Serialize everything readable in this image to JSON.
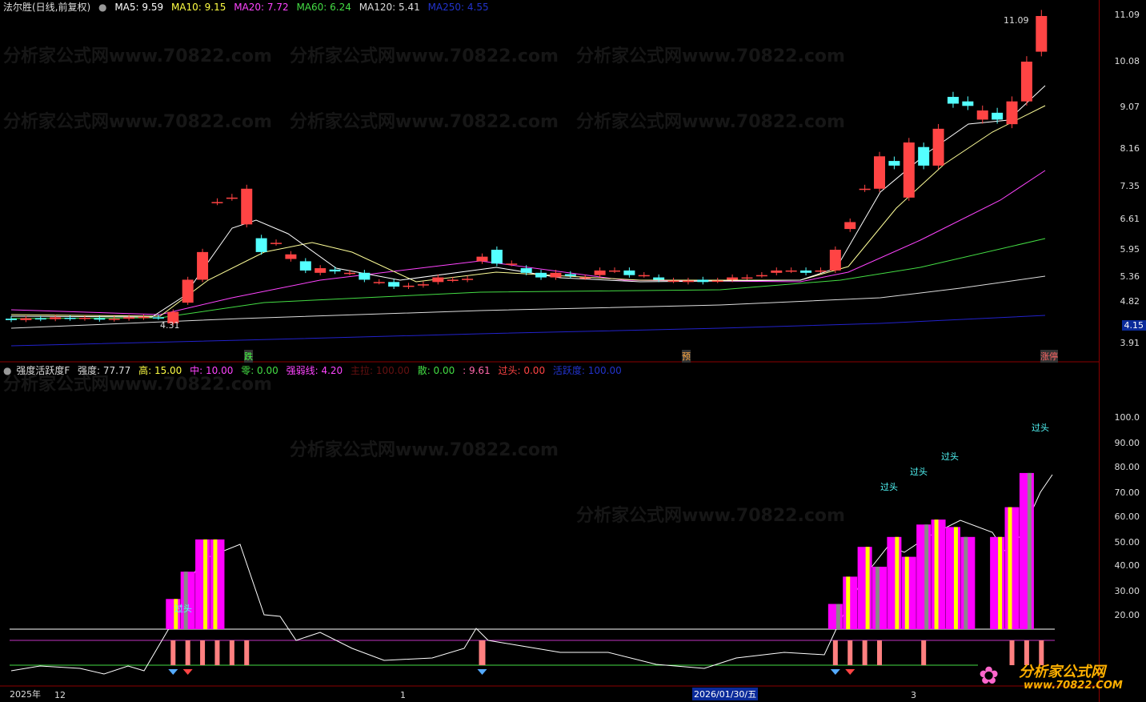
{
  "top_legend": {
    "title": "法尔胜(日线,前复权)",
    "ma5": "MA5: 9.59",
    "ma10": "MA10: 9.15",
    "ma20": "MA20: 7.72",
    "ma60": "MA60: 6.24",
    "ma120": "MA120: 5.41",
    "ma250": "MA250: 4.55"
  },
  "ind_legend": {
    "name": "强度活跃度F",
    "strength": "强度: 77.77",
    "high": "高: 15.00",
    "mid": "中: 10.00",
    "zero": "零: 0.00",
    "line": "强弱线: 4.20",
    "main": "主拉: 100.00",
    "scatter": "散: 0.00",
    "sep": ": 9.61",
    "over": "过头: 0.00",
    "active": "活跃度: 100.00"
  },
  "price_axis": [
    "11.09",
    "10.08",
    "9.07",
    "8.16",
    "7.35",
    "6.61",
    "5.95",
    "5.36",
    "4.82",
    "3.91"
  ],
  "price_current": "4.15",
  "ind_axis": [
    "100.0",
    "90.00",
    "80.00",
    "70.00",
    "60.00",
    "50.00",
    "40.00",
    "30.00",
    "20.00"
  ],
  "annotations": {
    "max": "11.09",
    "min": "4.31",
    "fall": "跌",
    "pre": "预",
    "limit": "涨停",
    "over": "过头"
  },
  "time_axis": [
    "2025年",
    "12",
    "1",
    "2026/01/30/五",
    "3"
  ],
  "watermark": "分析家公式网www.70822.com",
  "logo": {
    "name": "分析家公式网",
    "url": "www.70822.COM"
  },
  "colors": {
    "up": "#ff4444",
    "down": "#54ffff",
    "ma5": "#ffffff",
    "ma10": "#ffff66",
    "ma20": "#ff44ff",
    "ma60": "#44dd44",
    "ma120": "#dddddd",
    "ma250": "#2222cc",
    "bar": "#ff00ff",
    "stripe": "#ffff00",
    "gray": "#888888"
  },
  "chart_data": {
    "type": "candlestick",
    "candles": [
      [
        4.45,
        4.42
      ],
      [
        4.42,
        4.46
      ],
      [
        4.46,
        4.44
      ],
      [
        4.44,
        4.48
      ],
      [
        4.47,
        4.45
      ],
      [
        4.45,
        4.47
      ],
      [
        4.46,
        4.43
      ],
      [
        4.43,
        4.45
      ],
      [
        4.45,
        4.48
      ],
      [
        4.47,
        4.49
      ],
      [
        4.48,
        4.47
      ],
      [
        4.35,
        4.6
      ],
      [
        4.8,
        5.3
      ],
      [
        5.3,
        5.9
      ],
      [
        7.0,
        7.0
      ],
      [
        7.1,
        7.1
      ],
      [
        6.5,
        7.3
      ],
      [
        6.2,
        5.9
      ],
      [
        6.1,
        6.1
      ],
      [
        5.75,
        5.85
      ],
      [
        5.7,
        5.5
      ],
      [
        5.45,
        5.55
      ],
      [
        5.52,
        5.48
      ],
      [
        5.45,
        5.45
      ],
      [
        5.45,
        5.3
      ],
      [
        5.25,
        5.25
      ],
      [
        5.25,
        5.15
      ],
      [
        5.15,
        5.17
      ],
      [
        5.18,
        5.2
      ],
      [
        5.25,
        5.35
      ],
      [
        5.3,
        5.3
      ],
      [
        5.3,
        5.32
      ],
      [
        5.7,
        5.8
      ],
      [
        5.95,
        5.65
      ],
      [
        5.65,
        5.65
      ],
      [
        5.55,
        5.45
      ],
      [
        5.45,
        5.35
      ],
      [
        5.35,
        5.45
      ],
      [
        5.42,
        5.38
      ],
      [
        5.35,
        5.35
      ],
      [
        5.4,
        5.5
      ],
      [
        5.5,
        5.5
      ],
      [
        5.5,
        5.4
      ],
      [
        5.4,
        5.4
      ],
      [
        5.35,
        5.3
      ],
      [
        5.28,
        5.28
      ],
      [
        5.25,
        5.28
      ],
      [
        5.3,
        5.25
      ],
      [
        5.28,
        5.28
      ],
      [
        5.3,
        5.35
      ],
      [
        5.35,
        5.35
      ],
      [
        5.4,
        5.4
      ],
      [
        5.45,
        5.5
      ],
      [
        5.5,
        5.5
      ],
      [
        5.5,
        5.45
      ],
      [
        5.5,
        5.5
      ],
      [
        5.5,
        5.95
      ],
      [
        6.4,
        6.55
      ],
      [
        7.3,
        7.3
      ],
      [
        7.3,
        8.0
      ],
      [
        7.9,
        7.8
      ],
      [
        7.1,
        8.3
      ],
      [
        8.2,
        7.8
      ],
      [
        7.8,
        8.6
      ],
      [
        9.3,
        9.15
      ],
      [
        9.2,
        9.1
      ],
      [
        8.8,
        9.0
      ],
      [
        8.95,
        8.8
      ],
      [
        8.7,
        9.2
      ],
      [
        9.2,
        10.08
      ],
      [
        10.3,
        11.09
      ]
    ],
    "indicator_bars": [
      [
        11,
        27
      ],
      [
        12,
        38
      ],
      [
        13,
        51
      ],
      [
        14,
        51
      ],
      [
        56,
        25
      ],
      [
        57,
        36
      ],
      [
        58,
        48
      ],
      [
        59,
        40
      ],
      [
        60,
        52
      ],
      [
        61,
        44
      ],
      [
        62,
        57
      ],
      [
        63,
        59
      ],
      [
        64,
        56
      ],
      [
        65,
        52
      ],
      [
        67,
        52
      ],
      [
        68,
        64
      ],
      [
        69,
        77.77
      ]
    ],
    "ylim": [
      3.91,
      11.09
    ]
  }
}
